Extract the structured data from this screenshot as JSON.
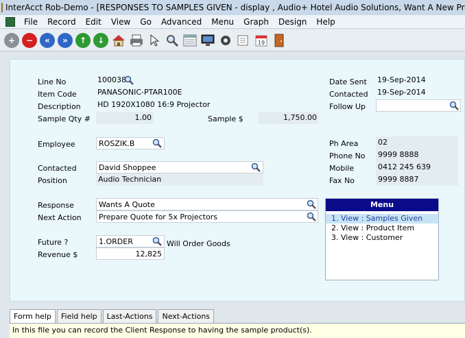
{
  "window": {
    "title": "InterAcct Rob-Demo - [RESPONSES TO SAMPLES GIVEN - display , Audio+ Hotel Audio Solutions, Want A New Projector for"
  },
  "menubar": {
    "items": [
      "File",
      "Record",
      "Edit",
      "View",
      "Go",
      "Advanced",
      "Menu",
      "Graph",
      "Design",
      "Help"
    ]
  },
  "toolbar": {
    "icons": [
      "add-icon",
      "delete-icon",
      "first-record-icon",
      "last-record-icon",
      "up-icon",
      "down-icon",
      "home-icon",
      "print-icon",
      "pointer-icon",
      "search-icon",
      "list-icon",
      "monitor-icon",
      "settings-icon",
      "export-icon",
      "calendar-icon",
      "exit-door-icon"
    ]
  },
  "form": {
    "line_no": {
      "label": "Line No",
      "value": "100038"
    },
    "item_code": {
      "label": "Item Code",
      "value": "PANASONIC-PTAR100E"
    },
    "description": {
      "label": "Description",
      "value": "HD 1920X1080 16:9 Projector"
    },
    "sample_qty": {
      "label": "Sample Qty #",
      "value": "1.00"
    },
    "sample_amount": {
      "label": "Sample $",
      "value": "1,750.00"
    },
    "employee": {
      "label": "Employee",
      "value": "ROSZIK.B"
    },
    "contacted": {
      "label": "Contacted",
      "value": "David Shoppee"
    },
    "position": {
      "label": "Position",
      "value": "Audio Technician"
    },
    "response": {
      "label": "Response",
      "value": "Wants A Quote"
    },
    "next_action": {
      "label": "Next Action",
      "value": "Prepare Quote for 5x Projectors"
    },
    "future": {
      "label": "Future ?",
      "value": "1.ORDER",
      "description": "Will Order Goods"
    },
    "revenue": {
      "label": "Revenue $",
      "value": "12,825"
    },
    "date_sent": {
      "label": "Date Sent",
      "value": "19-Sep-2014"
    },
    "contacted_date": {
      "label": "Contacted",
      "value": "19-Sep-2014"
    },
    "follow_up": {
      "label": "Follow Up",
      "value": ""
    },
    "ph_area": {
      "label": "Ph Area",
      "value": "02"
    },
    "phone_no": {
      "label": "Phone No",
      "value": "9999 8888"
    },
    "mobile": {
      "label": "Mobile",
      "value": "0412 245 639"
    },
    "fax_no": {
      "label": "Fax No",
      "value": "9999 8887"
    }
  },
  "side_menu": {
    "title": "Menu",
    "items": [
      "1. View : Samples Given",
      "2. View : Product Item",
      "3. View : Customer"
    ],
    "selected_index": 0
  },
  "bottom_tabs": {
    "items": [
      "Form help",
      "Field help",
      "Last-Actions",
      "Next-Actions"
    ],
    "active_index": 0
  },
  "help_text": "In this file you can record the Client Response to having the sample product(s).",
  "colors": {
    "menu_title_bg": "#0b0b8a",
    "menu_selected_bg": "#c8e3f5",
    "form_bg": "#eaf7fb",
    "help_bg": "#ffffe6"
  }
}
